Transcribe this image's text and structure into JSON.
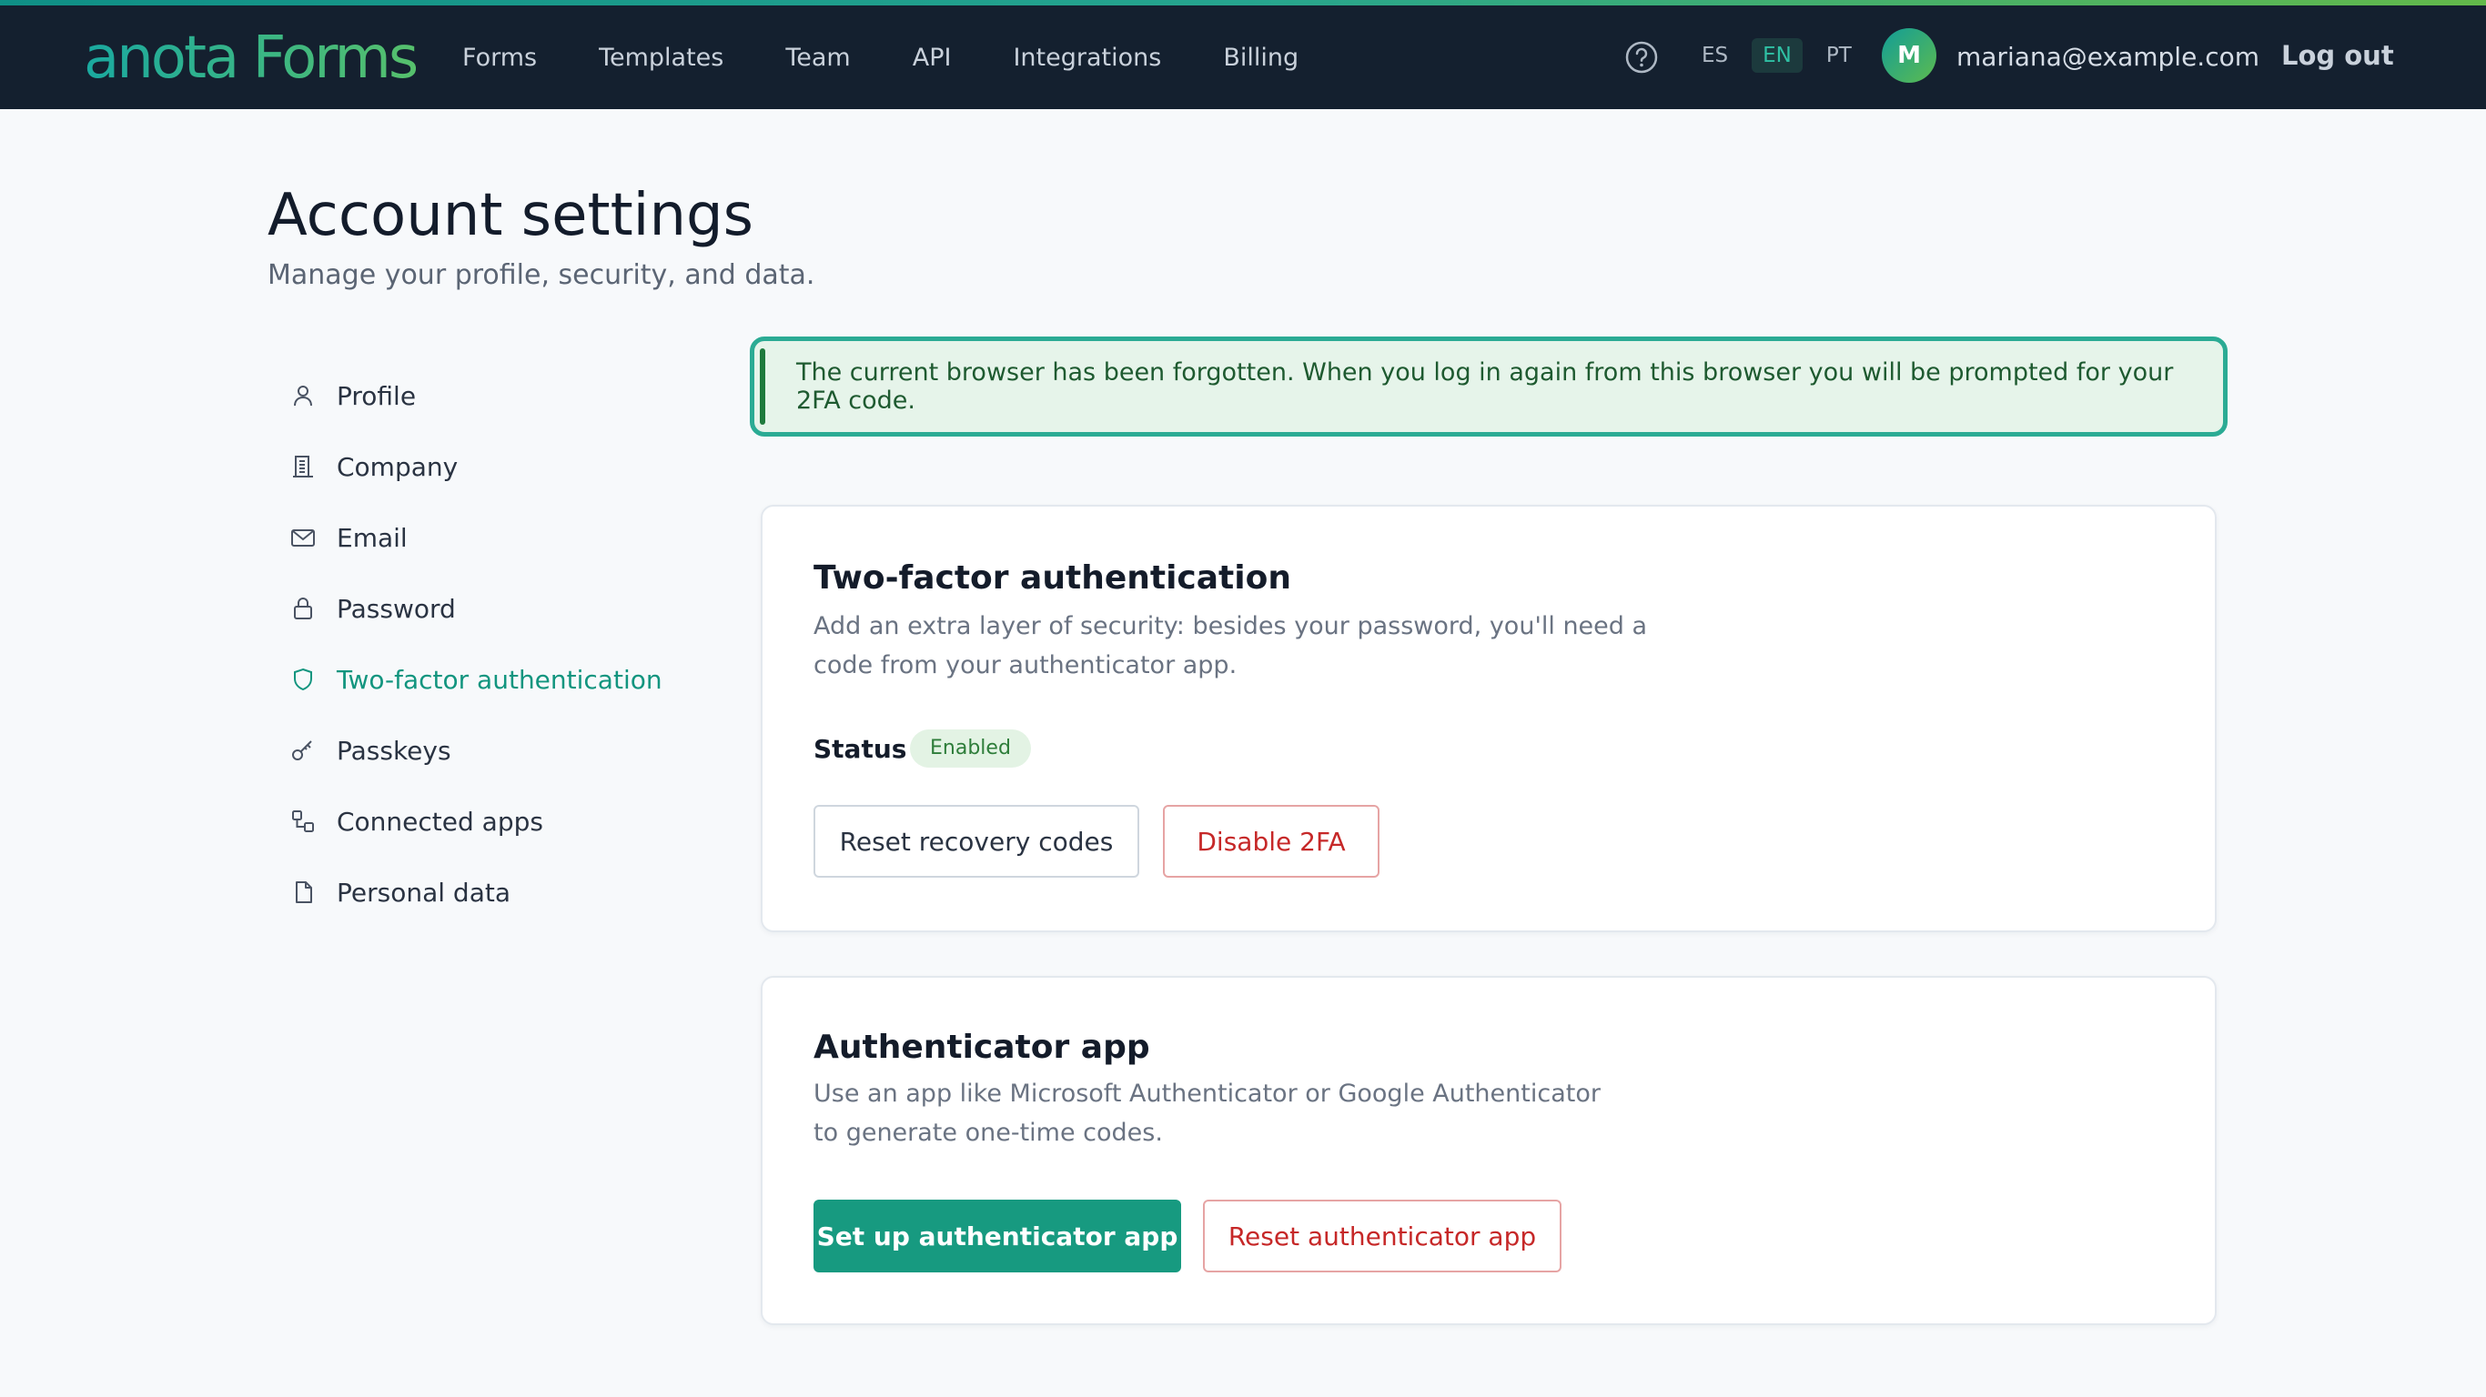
{
  "app": {
    "logo_text": "anota Forms",
    "colors": {
      "brand": "#179a80",
      "accent_gradient_start": "#0f8f86",
      "accent_gradient_end": "#63b94a",
      "topbar_bg": "#14202f",
      "danger": "#c62828",
      "success_bg": "#e6f4ea"
    }
  },
  "nav": {
    "items": [
      {
        "label": "Forms"
      },
      {
        "label": "Templates"
      },
      {
        "label": "Team"
      },
      {
        "label": "API"
      },
      {
        "label": "Integrations"
      },
      {
        "label": "Billing"
      }
    ]
  },
  "header": {
    "help_icon": "question-circle-icon",
    "languages": [
      {
        "label": "ES",
        "active": false
      },
      {
        "label": "EN",
        "active": true
      },
      {
        "label": "PT",
        "active": false
      }
    ],
    "avatar_initial": "M",
    "user_email": "mariana@example.com",
    "logout_label": "Log out"
  },
  "page": {
    "title": "Account settings",
    "subtitle": "Manage your profile, security, and data."
  },
  "sidebar": {
    "items": [
      {
        "label": "Profile",
        "icon": "user-icon",
        "active": false
      },
      {
        "label": "Company",
        "icon": "building-icon",
        "active": false
      },
      {
        "label": "Email",
        "icon": "mail-icon",
        "active": false
      },
      {
        "label": "Password",
        "icon": "lock-icon",
        "active": false
      },
      {
        "label": "Two-factor authentication",
        "icon": "shield-icon",
        "active": true
      },
      {
        "label": "Passkeys",
        "icon": "key-icon",
        "active": false
      },
      {
        "label": "Connected apps",
        "icon": "apps-link-icon",
        "active": false
      },
      {
        "label": "Personal data",
        "icon": "file-icon",
        "active": false
      }
    ]
  },
  "alert": {
    "text": "The current browser has been forgotten. When you log in again from this browser you will be prompted for your 2FA code."
  },
  "two_factor": {
    "title": "Two-factor authentication",
    "description": "Add an extra layer of security: besides your password, you'll need a code from your authenticator app.",
    "status_label": "Status",
    "status_value": "Enabled",
    "reset_codes_label": "Reset recovery codes",
    "disable_label": "Disable 2FA"
  },
  "authenticator": {
    "title": "Authenticator app",
    "description": "Use an app like Microsoft Authenticator or Google Authenticator to generate one-time codes.",
    "setup_label": "Set up authenticator app",
    "reset_label": "Reset authenticator app"
  }
}
